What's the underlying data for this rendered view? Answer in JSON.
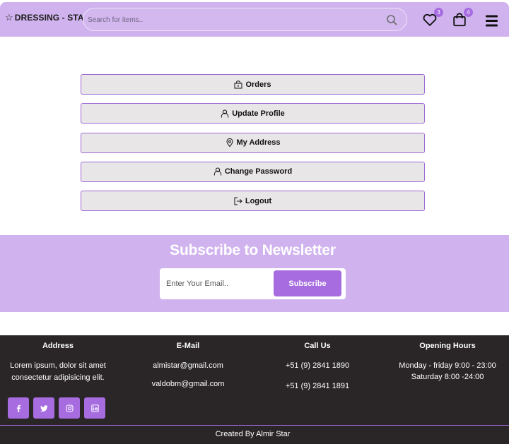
{
  "header": {
    "brand": "DRESSING - STAR",
    "search_placeholder": "Search for items..",
    "wishlist_count": "3",
    "cart_count": "4"
  },
  "menu": {
    "items": [
      {
        "label": "Orders",
        "icon": "shopping-bag-icon"
      },
      {
        "label": "Update Profile",
        "icon": "user-icon"
      },
      {
        "label": "My Address",
        "icon": "map-pin-icon"
      },
      {
        "label": "Change Password",
        "icon": "user-icon"
      },
      {
        "label": "Logout",
        "icon": "logout-icon"
      }
    ]
  },
  "newsletter": {
    "title": "Subscribe to Newsletter",
    "email_placeholder": "Enter Your Email..",
    "button_label": "Subscribe"
  },
  "footer": {
    "address": {
      "heading": "Address",
      "text": "Lorem ipsum, dolor sit amet consectetur adipisicing elit."
    },
    "email": {
      "heading": "E-Mail",
      "lines": [
        "almistar@gmail.com",
        "valdobm@gmail.com"
      ]
    },
    "call": {
      "heading": "Call Us",
      "lines": [
        "+51 (9) 2841 1890",
        "+51 (9) 2841 1891"
      ]
    },
    "hours": {
      "heading": "Opening Hours",
      "lines": [
        "Monday - friday 9:00 - 23:00",
        "Saturday 8:00 -24:00"
      ]
    },
    "socials": [
      "facebook-icon",
      "twitter-icon",
      "instagram-icon",
      "linkedin-icon"
    ],
    "credit": "Created By Almir Star"
  },
  "colors": {
    "accent": "#a66ce0",
    "header_bg": "#d0b3ee",
    "footer_bg": "#2a2627",
    "button_bg": "#e8e6e6"
  }
}
